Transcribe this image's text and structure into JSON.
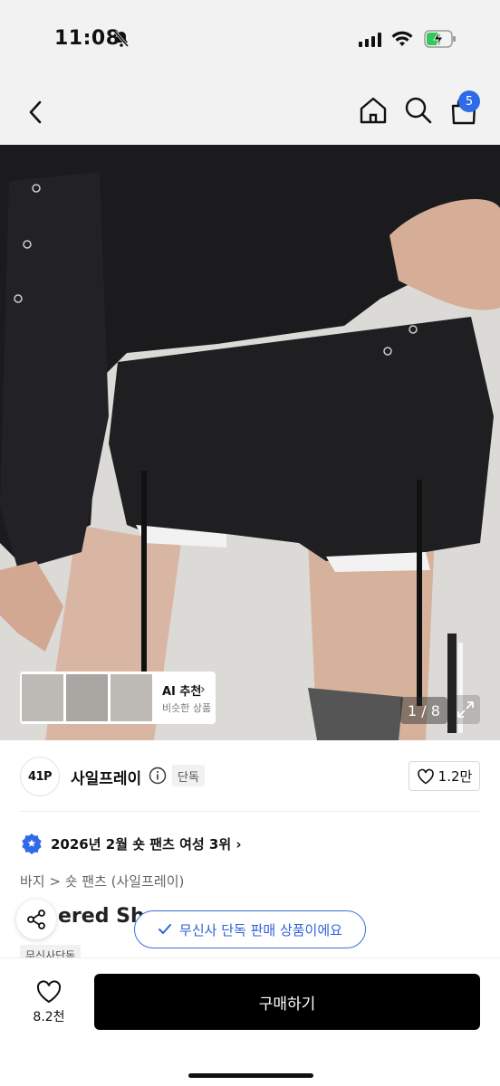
{
  "status_bar": {
    "time": "11:08"
  },
  "header": {
    "cart_count": "5"
  },
  "gallery": {
    "ai_title": "AI 추천",
    "ai_subtitle": "비슷한 상품",
    "page_counter": "1 / 8"
  },
  "brand": {
    "logo_text": "41P",
    "name": "사일프레이",
    "exclusive_label": "단독",
    "like_count": "1.2만"
  },
  "ranking": {
    "text": "2026년 2월 숏 팬츠 여성 3위"
  },
  "breadcrumb": "바지 > 숏 팬츠 (사일프레이)",
  "product": {
    "title_visible": "ered Sh",
    "store_tag": "무신사단독"
  },
  "toast": {
    "text": "무신사 단독 판매 상품이에요"
  },
  "bottom": {
    "wish_count": "8.2천",
    "buy_label": "구매하기"
  },
  "colors": {
    "accent_blue": "#2f6be8",
    "buy_button": "#000000",
    "background": "#ffffff",
    "header_bg": "#f2f2f2"
  }
}
